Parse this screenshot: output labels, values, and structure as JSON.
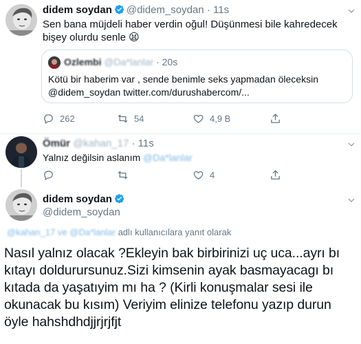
{
  "tweet1": {
    "name": "didem soydan",
    "handle": "@didem_soydan",
    "separator": "·",
    "time": "11s",
    "text": "Sen bana müjdeli haber verdin oğul! Düşünmesi bile kahredecek bişey olurdu senle",
    "emoji": "😫",
    "quote": {
      "name": "Ozlembi",
      "handle": "@Da*lanlar",
      "separator": "·",
      "time": "20s",
      "line1": "Kötü bir haberim var , sende benimle seks yapmadan öleceksin",
      "mention": "@didem_soydan",
      "link": "twitter.com/durushabercom/..."
    },
    "stats": {
      "replies": "262",
      "retweets": "54",
      "likes": "4,9 B"
    }
  },
  "tweet2": {
    "name": "Ömür",
    "handle": "@kahan_17",
    "separator": "·",
    "time": "11s",
    "text": "Yalnız değilsin aslanım",
    "mention": "@Da*lanlar",
    "stats": {
      "replies": "",
      "retweets": "",
      "likes": "4"
    }
  },
  "tweet3": {
    "name": "didem soydan",
    "handle": "@didem_soydan",
    "reply_mentions": "@kahan_17 ve @Da*lanlar",
    "reply_suffix": "adlı kullanıcılara yanıt olarak",
    "text": "Nasıl yalnız olacak ?Ekleyin bak birbirinizi uç uca...ayrı bı kıtayı doldurursunuz.Sizi kimsenin ayak basmayacagı bı kıtada da yaşatıyim  mı ha ? (Kirli konuşmalar sesi ile okunacak bu kısım) Veriyim elinize telefonu yazıp durun öyle hahshdhdjjrjrjfjt"
  },
  "icons": {
    "reply": "reply-icon",
    "retweet": "retweet-icon",
    "like": "like-icon",
    "share": "share-icon",
    "verified": "verified-badge-icon",
    "more": "chevron-down-icon"
  },
  "colors": {
    "link": "#1da1f2",
    "muted": "#657786",
    "verified": "#1da1f2",
    "border": "#e6ecf0"
  }
}
